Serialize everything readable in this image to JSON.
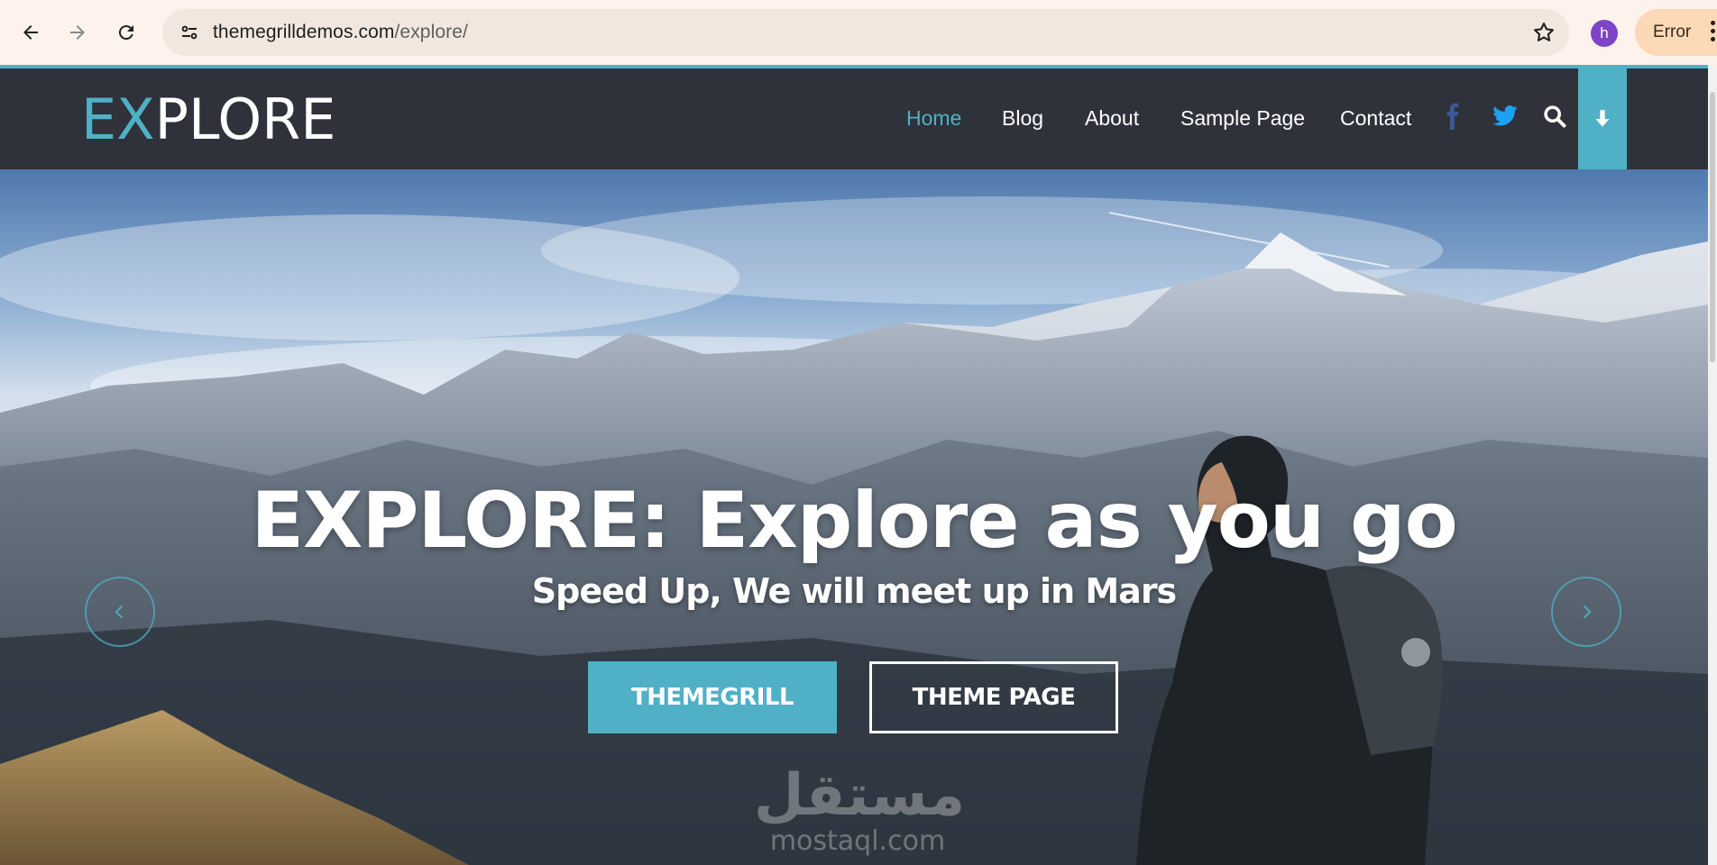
{
  "browser": {
    "url_host": "themegrilldemos.com",
    "url_path": "/explore/",
    "profile_initial": "h",
    "status_pill": "Error",
    "icons": [
      "back-icon",
      "forward-icon",
      "reload-icon",
      "site-info-icon",
      "bookmark-star-icon",
      "kebab-menu-icon"
    ]
  },
  "site": {
    "logo_accent": "EX",
    "logo_rest": "PLORE",
    "menu": [
      "Home",
      "Blog",
      "About",
      "Sample Page",
      "Contact"
    ],
    "active_menu": "Home",
    "social_icons": [
      "facebook-icon",
      "twitter-icon"
    ],
    "tool_icons": [
      "search-icon",
      "arrow-down-icon"
    ]
  },
  "hero": {
    "title": "EXPLORE: Explore as you go",
    "subtitle": "Speed Up, We will meet up in Mars",
    "primary_button": "THEMEGRILL",
    "secondary_button": "THEME PAGE",
    "watermark_arabic": "مستقل",
    "watermark_latin": "mostaql.com"
  },
  "colors": {
    "accent": "#4fb0c6",
    "header_bg": "#2f323a",
    "chrome_bg": "#fdf3ec",
    "omnibox_bg": "#f2e7de",
    "avatar_bg": "#7e44c8",
    "error_pill_bg": "#fbd9b6",
    "facebook": "#3b5998",
    "twitter": "#1da1f2"
  }
}
